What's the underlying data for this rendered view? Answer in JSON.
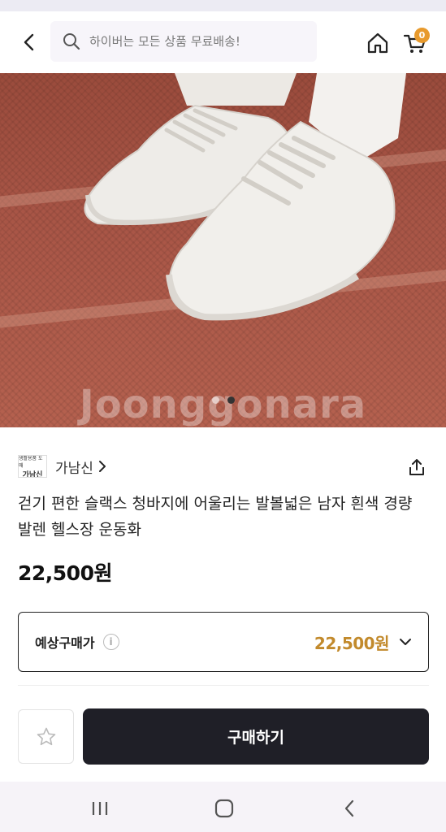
{
  "header": {
    "search_placeholder": "하이버는 모든 상품 무료배송!",
    "cart_count": "0"
  },
  "photo": {
    "watermark": "Joonggonara",
    "slide_count": 2,
    "active_slide": 2
  },
  "product": {
    "seller_logo_text_top": "생활용품 도매",
    "seller_logo_text_bottom": "가남신",
    "seller_name": "가남신",
    "title": "걷기 편한 슬랙스 청바지에 어울리는 발볼넓은 남자 흰색 경량 발렌 헬스장 운동화",
    "price": "22,500원"
  },
  "estimate": {
    "label": "예상구매가",
    "info_symbol": "i",
    "value": "22,500원"
  },
  "actions": {
    "buy_label": "구매하기"
  },
  "colors": {
    "accent_orange": "#e89a2c",
    "price_gold": "#c28a2c",
    "buy_button": "#1f1f27"
  }
}
